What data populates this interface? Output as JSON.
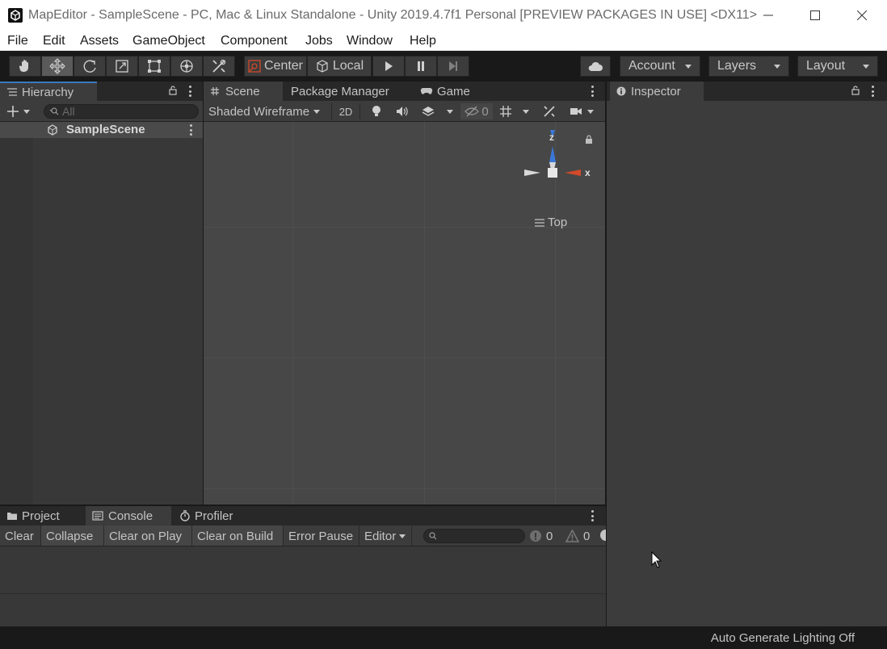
{
  "window": {
    "title": "MapEditor - SampleScene - PC, Mac & Linux Standalone - Unity 2019.4.7f1 Personal [PREVIEW PACKAGES IN USE] <DX11>"
  },
  "menu": [
    "File",
    "Edit",
    "Assets",
    "GameObject",
    "Component",
    "Jobs",
    "Window",
    "Help"
  ],
  "toolbar": {
    "tools": [
      "hand-tool",
      "move-tool",
      "rotate-tool",
      "scale-tool",
      "rect-tool",
      "transform-tool",
      "custom-tool"
    ],
    "active_tool": "move-tool",
    "pivot_label": "Center",
    "space_label": "Local",
    "account_label": "Account",
    "layers_label": "Layers",
    "layout_label": "Layout"
  },
  "hierarchy": {
    "tab_label": "Hierarchy",
    "search_placeholder": "All",
    "scene_name": "SampleScene"
  },
  "scene_view": {
    "tabs": [
      "Scene",
      "Package Manager",
      "Game"
    ],
    "shading_mode": "Shaded Wireframe",
    "mode_2d": "2D",
    "hidden_count": "0",
    "gizmo_axis_z": "z",
    "gizmo_axis_x": "x",
    "view_label": "Top"
  },
  "inspector": {
    "tab_label": "Inspector"
  },
  "bottom_panel": {
    "tabs": [
      "Project",
      "Console",
      "Profiler"
    ],
    "console_buttons": [
      "Clear",
      "Collapse",
      "Clear on Play",
      "Clear on Build",
      "Error Pause"
    ],
    "editor_dropdown": "Editor",
    "error_count": "0",
    "warning_count": "0"
  },
  "status": {
    "lighting": "Auto Generate Lighting Off"
  },
  "colors": {
    "accent": "#3a79bb",
    "axis_x": "#d24a2a",
    "axis_z": "#3a78d8"
  }
}
